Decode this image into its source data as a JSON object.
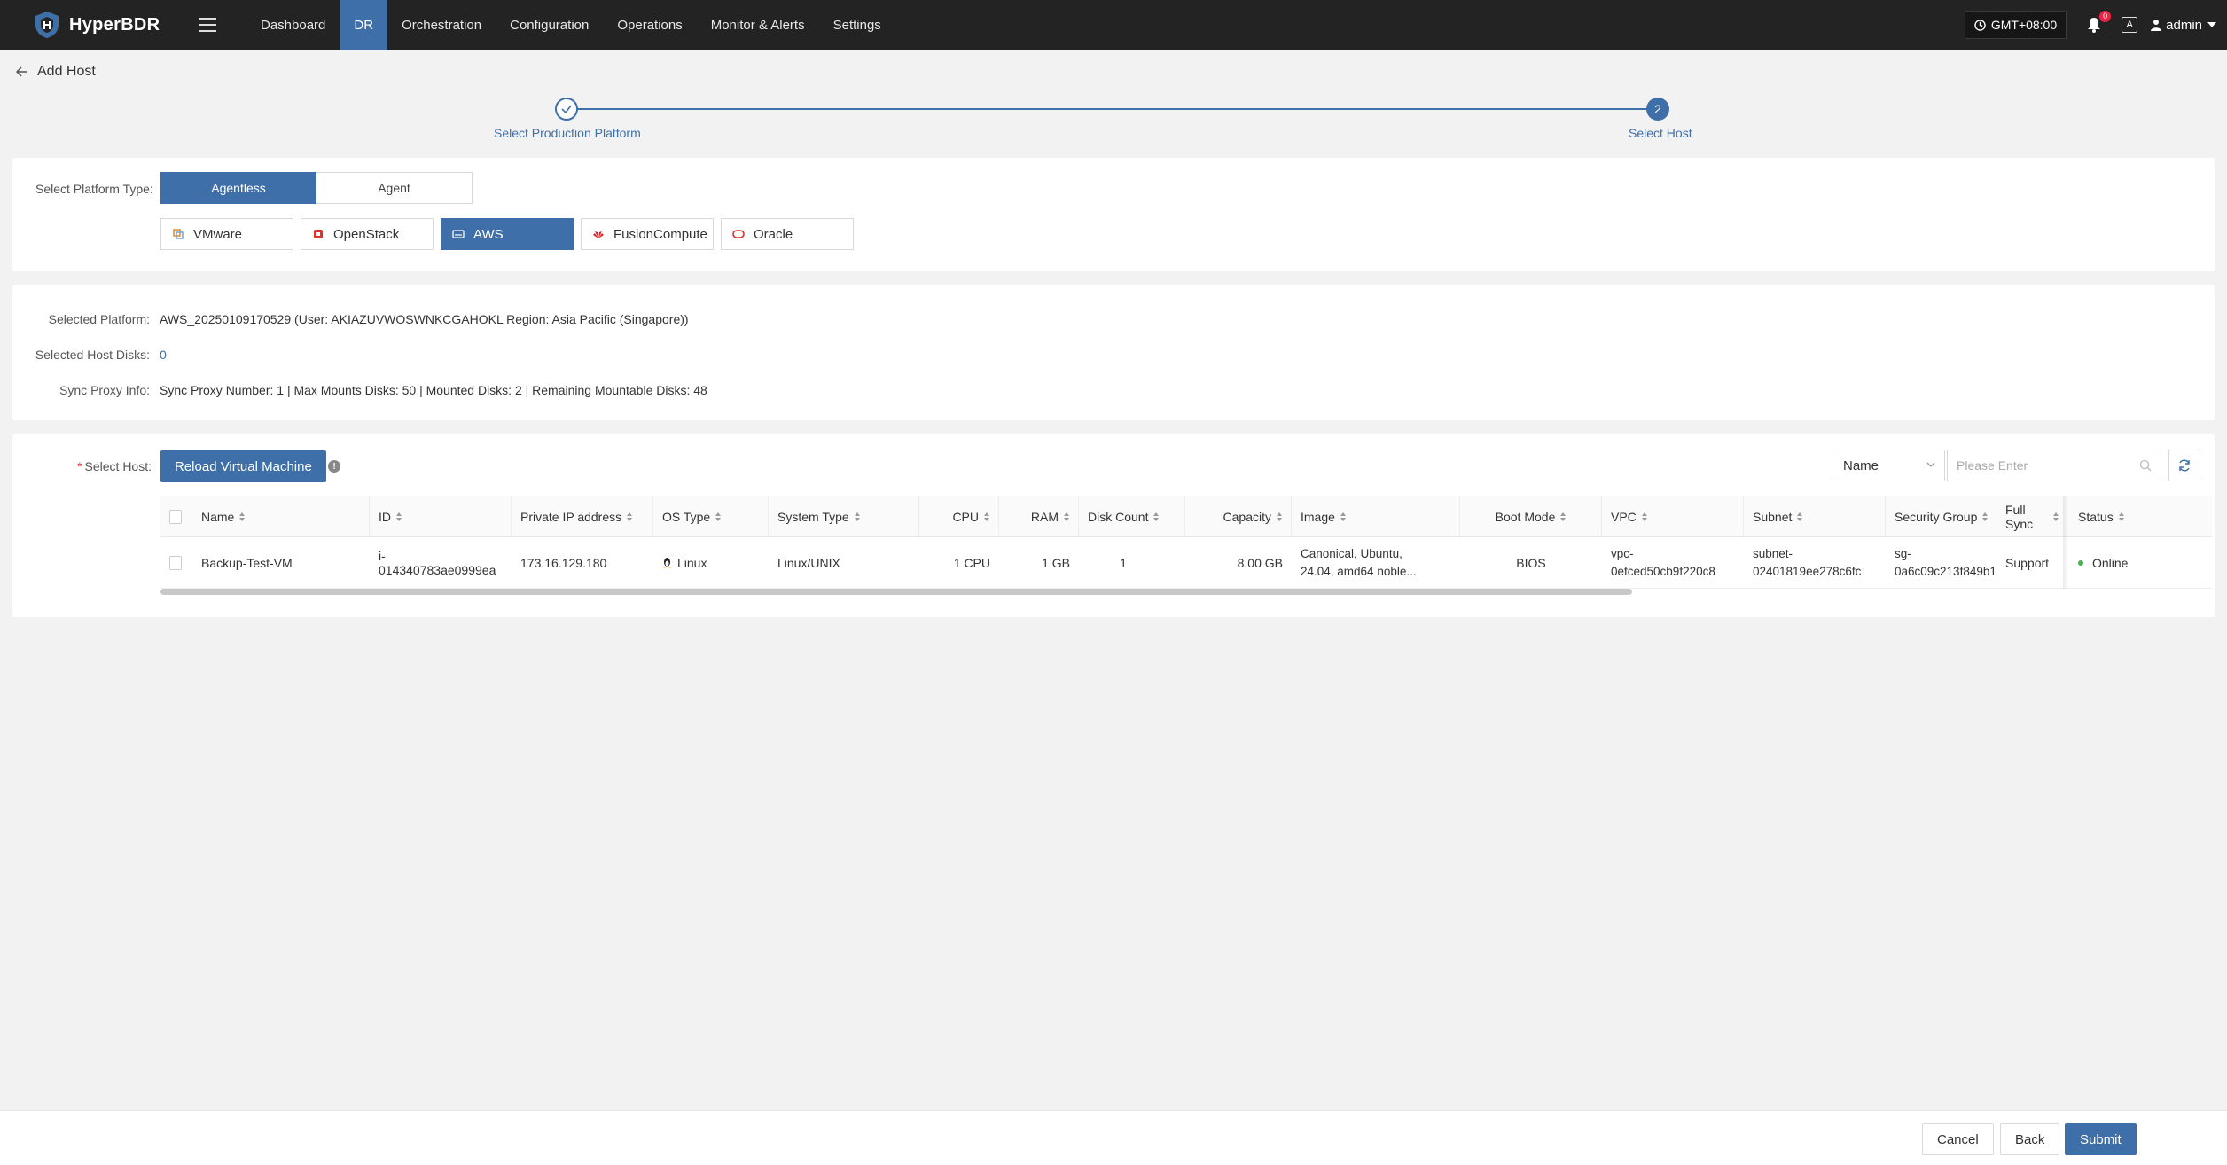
{
  "app": {
    "name": "HyperBDR"
  },
  "nav": {
    "items": [
      {
        "label": "Dashboard",
        "active": false
      },
      {
        "label": "DR",
        "active": true
      },
      {
        "label": "Orchestration",
        "active": false
      },
      {
        "label": "Configuration",
        "active": false
      },
      {
        "label": "Operations",
        "active": false
      },
      {
        "label": "Monitor & Alerts",
        "active": false
      },
      {
        "label": "Settings",
        "active": false
      }
    ],
    "timezone": "GMT+08:00",
    "notification_count": "0",
    "lang_icon": "A",
    "user": "admin"
  },
  "page": {
    "title": "Add Host"
  },
  "steps": [
    {
      "label": "Select Production Platform",
      "state": "done"
    },
    {
      "label": "Select Host",
      "number": "2",
      "state": "current"
    }
  ],
  "platform_type": {
    "label": "Select Platform Type:",
    "options": [
      "Agentless",
      "Agent"
    ],
    "selected": "Agentless"
  },
  "platforms": {
    "items": [
      {
        "label": "VMware",
        "icon": "vmware-icon",
        "color": "#e08a2c"
      },
      {
        "label": "OpenStack",
        "icon": "openstack-icon",
        "color": "#e0302c"
      },
      {
        "label": "AWS",
        "icon": "aws-icon",
        "color": "#ffffff"
      },
      {
        "label": "FusionCompute",
        "icon": "huawei-icon",
        "color": "#d7272c"
      },
      {
        "label": "Oracle",
        "icon": "oracle-icon",
        "color": "#e0302c"
      }
    ],
    "selected": "AWS"
  },
  "info": {
    "platform_label": "Selected Platform:",
    "platform_value": "AWS_20250109170529 (User: AKIAZUVWOSWNKCGAHOKL Region: Asia Pacific (Singapore))",
    "disks_label": "Selected Host Disks:",
    "disks_value": "0",
    "proxy_label": "Sync Proxy Info:",
    "proxy_value": "Sync Proxy Number: 1 | Max Mounts Disks: 50 | Mounted Disks: 2 | Remaining Mountable Disks: 48"
  },
  "host_select": {
    "label": "Select Host:",
    "reload_label": "Reload Virtual Machine",
    "filter_field": "Name",
    "search_placeholder": "Please Enter"
  },
  "table": {
    "columns": [
      "Name",
      "ID",
      "Private IP address",
      "OS Type",
      "System Type",
      "CPU",
      "RAM",
      "Disk Count",
      "Capacity",
      "Image",
      "Boot Mode",
      "VPC",
      "Subnet",
      "Security Group",
      "Full Sync",
      "Status"
    ],
    "rows": [
      {
        "name": "Backup-Test-VM",
        "id": "i-014340783ae0999ea",
        "ip": "173.16.129.180",
        "os": "Linux",
        "system": "Linux/UNIX",
        "cpu": "1 CPU",
        "ram": "1 GB",
        "disks": "1",
        "capacity": "8.00 GB",
        "image_l1": "Canonical, Ubuntu,",
        "image_l2": "24.04, amd64 noble...",
        "boot": "BIOS",
        "vpc_l1": "vpc-",
        "vpc_l2": "0efced50cb9f220c8",
        "subnet_l1": "subnet-",
        "subnet_l2": "02401819ee278c6fc",
        "sg_l1": "sg-",
        "sg_l2": "0a6c09c213f849b1b",
        "full_sync": "Support",
        "status": "Online"
      }
    ]
  },
  "footer": {
    "cancel": "Cancel",
    "back": "Back",
    "submit": "Submit"
  },
  "colors": {
    "primary": "#3f6fa8",
    "topbar": "#232323",
    "online": "#4caf50"
  }
}
